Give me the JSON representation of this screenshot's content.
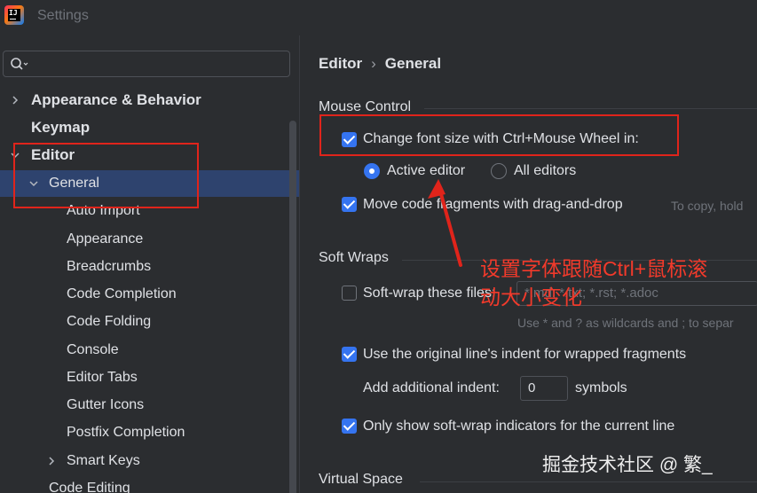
{
  "window": {
    "title": "Settings"
  },
  "search": {
    "placeholder": ""
  },
  "tree": [
    {
      "label": "Appearance & Behavior",
      "expanded": false,
      "bold": true
    },
    {
      "label": "Keymap",
      "bold": true
    },
    {
      "label": "Editor",
      "expanded": true,
      "bold": true
    },
    {
      "label": "General",
      "expanded": true,
      "selected": true
    },
    {
      "label": "Auto Import"
    },
    {
      "label": "Appearance"
    },
    {
      "label": "Breadcrumbs"
    },
    {
      "label": "Code Completion"
    },
    {
      "label": "Code Folding"
    },
    {
      "label": "Console"
    },
    {
      "label": "Editor Tabs"
    },
    {
      "label": "Gutter Icons"
    },
    {
      "label": "Postfix Completion"
    },
    {
      "label": "Smart Keys",
      "expanded": false
    },
    {
      "label": "Code Editing"
    }
  ],
  "breadcrumb": {
    "parent": "Editor",
    "separator": "›",
    "current": "General"
  },
  "mouse_control": {
    "title": "Mouse Control",
    "font_size_wheel": {
      "label": "Change font size with Ctrl+Mouse Wheel in:",
      "checked": true
    },
    "active_editor": {
      "label": "Active editor",
      "selected": true
    },
    "all_editors": {
      "label": "All editors",
      "selected": false
    },
    "drag_drop": {
      "label": "Move code fragments with drag-and-drop",
      "checked": true,
      "hint": "To copy, hold"
    }
  },
  "soft_wraps": {
    "title": "Soft Wraps",
    "soft_wrap_files": {
      "label": "Soft-wrap these files:",
      "checked": false,
      "value": "*.md; *.txt; *.rst; *.adoc"
    },
    "wildcard_hint": "Use * and ? as wildcards and ; to separ",
    "original_indent": {
      "label": "Use the original line's indent for wrapped fragments",
      "checked": true
    },
    "additional_indent": {
      "label": "Add additional indent:",
      "value": "0",
      "unit": "symbols"
    },
    "only_current_line": {
      "label": "Only show soft-wrap indicators for the current line",
      "checked": true
    }
  },
  "virtual_space": {
    "title": "Virtual Space"
  },
  "annotation": {
    "line1": "设置字体跟随Ctrl+鼠标滚",
    "line2": "动大小变化"
  },
  "watermark": "掘金技术社区 @ 繁_",
  "colors": {
    "accent": "#3574f0",
    "selection": "#2e436e",
    "annotation": "#e0241b",
    "background": "#2b2d30"
  }
}
